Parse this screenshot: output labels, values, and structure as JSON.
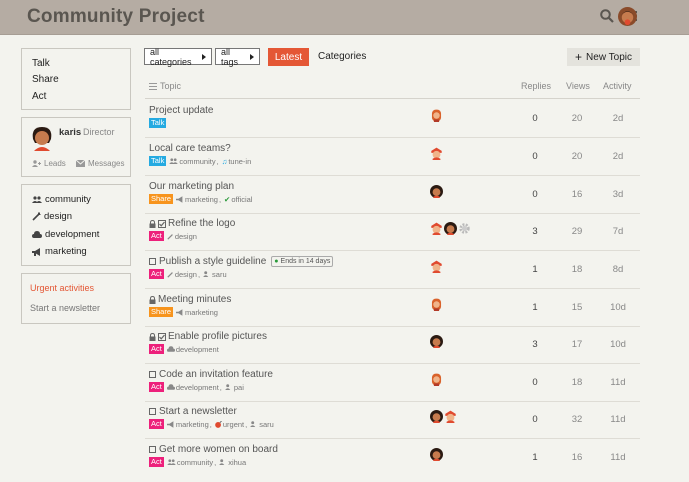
{
  "header": {
    "title": "Community Project"
  },
  "sidebar": {
    "nav": [
      "Talk",
      "Share",
      "Act"
    ],
    "user": {
      "name": "karis",
      "role": "Director",
      "leads_label": "Leads",
      "messages_label": "Messages"
    },
    "categories": [
      "community",
      "design",
      "development",
      "marketing"
    ],
    "urgent_label": "Urgent activities",
    "newsletter_label": "Start a newsletter"
  },
  "toolbar": {
    "all_categories": "all categories",
    "all_tags": "all tags",
    "latest": "Latest",
    "categories": "Categories",
    "new_topic": "New Topic"
  },
  "table": {
    "headers": {
      "topic": "Topic",
      "replies": "Replies",
      "views": "Views",
      "activity": "Activity"
    }
  },
  "colors": {
    "accent": "#e45735",
    "talk": "#25aae1",
    "share": "#f7941d",
    "act": "#ed207b",
    "header_bg": "#b5aca3"
  },
  "topics": [
    {
      "title": "Project update",
      "category": "Talk",
      "cat_color": "#25aae1",
      "tags": [],
      "replies": "0",
      "views": "20",
      "activity": "2d"
    },
    {
      "title": "Local care teams?",
      "category": "Talk",
      "cat_color": "#25aae1",
      "tags": [
        "community",
        "tune-in"
      ],
      "replies": "0",
      "views": "20",
      "activity": "2d"
    },
    {
      "title": "Our marketing plan",
      "category": "Share",
      "cat_color": "#f7941d",
      "tags": [
        "marketing",
        "official"
      ],
      "replies": "0",
      "views": "16",
      "activity": "3d"
    },
    {
      "title": "Refine the logo",
      "category": "Act",
      "cat_color": "#ed207b",
      "tags": [
        "design"
      ],
      "replies": "3",
      "views": "29",
      "activity": "7d"
    },
    {
      "title": "Publish a style guideline",
      "category": "Act",
      "cat_color": "#ed207b",
      "tags": [
        "design",
        "saru"
      ],
      "ends_label": "Ends in 14 days",
      "replies": "1",
      "views": "18",
      "activity": "8d"
    },
    {
      "title": "Meeting minutes",
      "category": "Share",
      "cat_color": "#f7941d",
      "tags": [
        "marketing"
      ],
      "replies": "1",
      "views": "15",
      "activity": "10d"
    },
    {
      "title": "Enable profile pictures",
      "category": "Act",
      "cat_color": "#ed207b",
      "tags": [
        "development"
      ],
      "replies": "3",
      "views": "17",
      "activity": "10d"
    },
    {
      "title": "Code an invitation feature",
      "category": "Act",
      "cat_color": "#ed207b",
      "tags": [
        "development",
        "pai"
      ],
      "replies": "0",
      "views": "18",
      "activity": "11d"
    },
    {
      "title": "Start a newsletter",
      "category": "Act",
      "cat_color": "#ed207b",
      "tags": [
        "marketing",
        "urgent",
        "saru"
      ],
      "replies": "0",
      "views": "32",
      "activity": "11d"
    },
    {
      "title": "Get more women on board",
      "category": "Act",
      "cat_color": "#ed207b",
      "tags": [
        "community",
        "xihua"
      ],
      "replies": "1",
      "views": "16",
      "activity": "11d"
    }
  ]
}
